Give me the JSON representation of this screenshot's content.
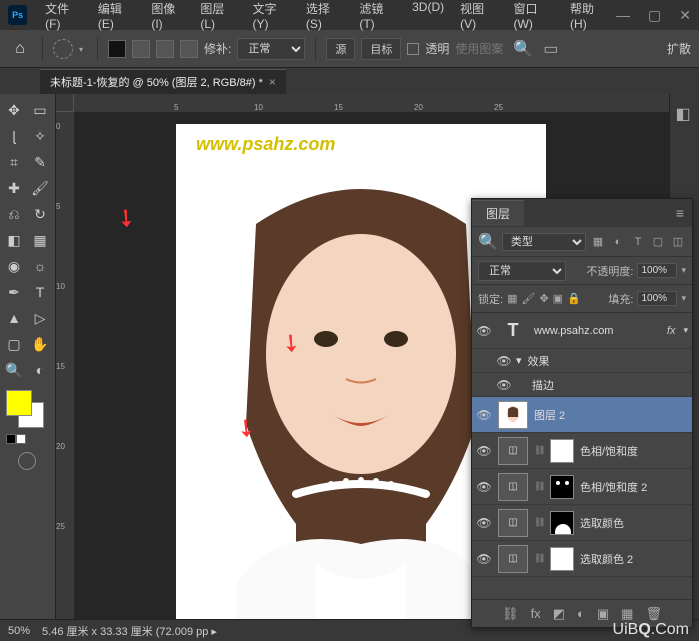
{
  "menubar": [
    "文件(F)",
    "编辑(E)",
    "图像(I)",
    "图层(L)",
    "文字(Y)",
    "选择(S)",
    "滤镜(T)",
    "3D(D)",
    "视图(V)",
    "窗口(W)",
    "帮助(H)"
  ],
  "options": {
    "patch_label": "修补:",
    "patch_mode": "正常",
    "btn_source": "源",
    "btn_dest": "目标",
    "cb_transparent": "透明",
    "use_pattern": "使用图案",
    "expand_label": "扩散"
  },
  "doc": {
    "tab_title": "未标题-1-恢复的 @ 50% (图层 2, RGB/8#) *"
  },
  "ruler_h": [
    "5",
    "10",
    "15",
    "20",
    "25"
  ],
  "ruler_v": [
    "0",
    "5",
    "10",
    "15",
    "20",
    "25"
  ],
  "watermark": "www.psahz.com",
  "layers_panel": {
    "tab": "图层",
    "filter_prefix": "🔍",
    "filter_type": "类型",
    "blend_mode": "正常",
    "opacity_label": "不透明度:",
    "opacity_value": "100%",
    "lock_label": "锁定:",
    "fill_label": "填充:",
    "fill_value": "100%",
    "layers": [
      {
        "kind": "text",
        "name": "www.psahz.com",
        "fx": "fx"
      },
      {
        "kind": "sub",
        "name": "效果",
        "eye": true,
        "toggle": "▾"
      },
      {
        "kind": "sub",
        "name": "描边",
        "eye": true
      },
      {
        "kind": "image",
        "name": "图层 2",
        "selected": true
      },
      {
        "kind": "adj",
        "name": "色相/饱和度",
        "mask": "white"
      },
      {
        "kind": "adj",
        "name": "色相/饱和度 2",
        "mask": "black"
      },
      {
        "kind": "adj",
        "name": "选取颜色",
        "mask": "partial"
      },
      {
        "kind": "adj",
        "name": "选取颜色 2",
        "mask": "white"
      }
    ]
  },
  "status": {
    "zoom": "50%",
    "dims": "5.46 厘米 x 33.33 厘米 (72.009 pp ▸"
  },
  "bottom_wm_1": "UiB",
  "bottom_wm_2": "Q",
  "bottom_wm_3": ".Com",
  "colors": {
    "fg": "#ffff00",
    "bg": "#ffffff"
  }
}
